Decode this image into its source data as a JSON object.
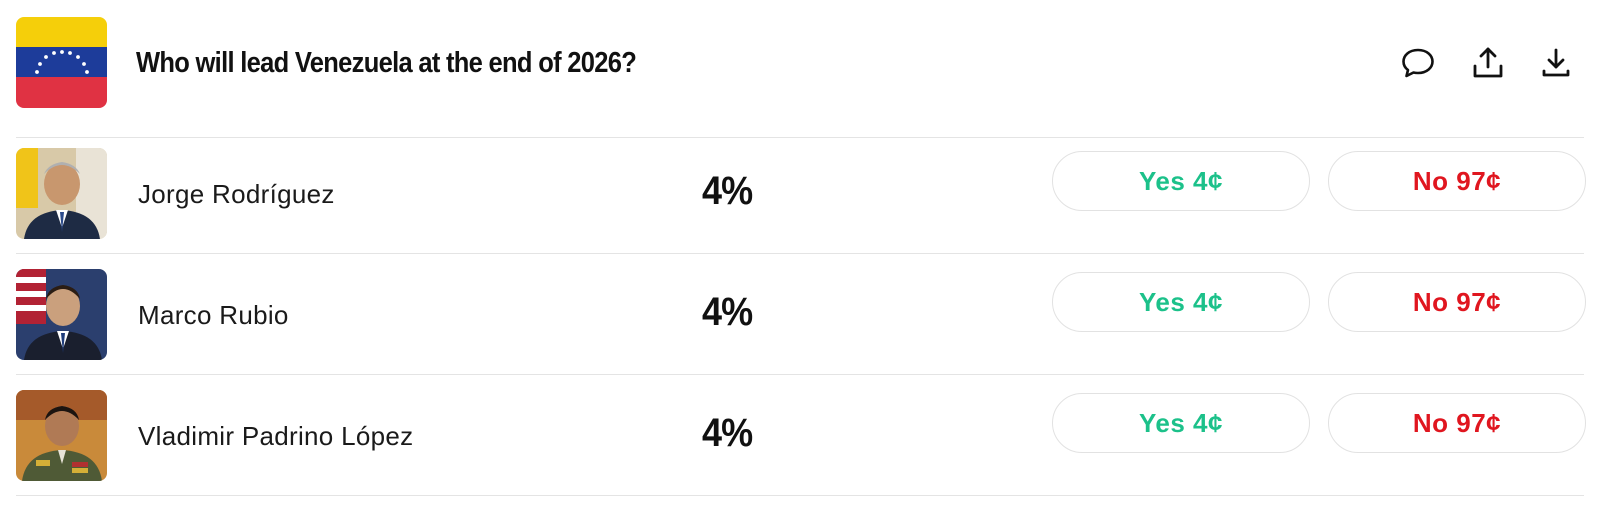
{
  "market": {
    "title": "Who will lead Venezuela at the end of 2026?",
    "flag": {
      "name": "venezuela-flag",
      "colors": [
        "#f5cf0a",
        "#1d3c9a",
        "#e03243"
      ]
    }
  },
  "header_actions": [
    {
      "name": "comment-icon"
    },
    {
      "name": "share-icon"
    },
    {
      "name": "download-icon"
    }
  ],
  "outcomes": [
    {
      "name": "Jorge Rodríguez",
      "probability": "4%",
      "yes_label": "Yes 4¢",
      "no_label": "No 97¢"
    },
    {
      "name": "Marco Rubio",
      "probability": "4%",
      "yes_label": "Yes 4¢",
      "no_label": "No 97¢"
    },
    {
      "name": "Vladimir Padrino López",
      "probability": "4%",
      "yes_label": "Yes 4¢",
      "no_label": "No 97¢"
    }
  ],
  "colors": {
    "yes": "#1cc18a",
    "no": "#e0161f",
    "divider": "#e4e4e4"
  }
}
